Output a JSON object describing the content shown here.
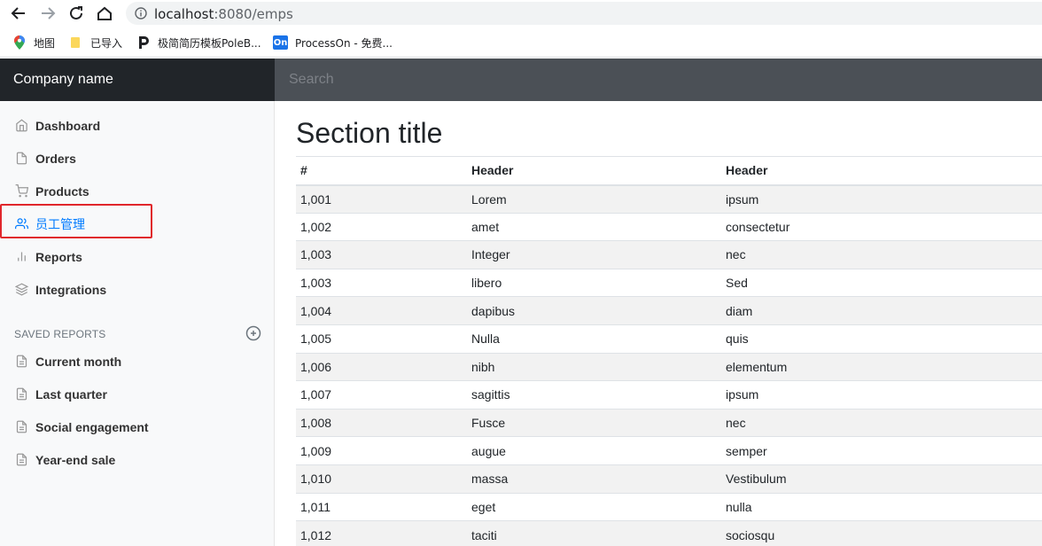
{
  "browser": {
    "url_host": "localhost",
    "url_path": ":8080/emps",
    "bookmarks": [
      "地图",
      "已导入",
      "极简简历模板PoleB...",
      "ProcessOn - 免费..."
    ],
    "processon_icon_text": "On"
  },
  "navbar": {
    "brand": "Company name",
    "search_placeholder": "Search"
  },
  "sidebar": {
    "items": [
      {
        "label": "Dashboard",
        "icon": "home-icon"
      },
      {
        "label": "Orders",
        "icon": "file-icon"
      },
      {
        "label": "Products",
        "icon": "shopping-cart-icon"
      },
      {
        "label": "员工管理",
        "icon": "users-icon",
        "active": true
      },
      {
        "label": "Reports",
        "icon": "bar-chart-icon"
      },
      {
        "label": "Integrations",
        "icon": "layers-icon"
      }
    ],
    "saved_heading": "SAVED REPORTS",
    "saved_items": [
      {
        "label": "Current month",
        "icon": "file-text-icon"
      },
      {
        "label": "Last quarter",
        "icon": "file-text-icon"
      },
      {
        "label": "Social engagement",
        "icon": "file-text-icon"
      },
      {
        "label": "Year-end sale",
        "icon": "file-text-icon"
      }
    ]
  },
  "main": {
    "title": "Section title",
    "columns": [
      "#",
      "Header",
      "Header"
    ],
    "rows": [
      [
        "1,001",
        "Lorem",
        "ipsum"
      ],
      [
        "1,002",
        "amet",
        "consectetur"
      ],
      [
        "1,003",
        "Integer",
        "nec"
      ],
      [
        "1,003",
        "libero",
        "Sed"
      ],
      [
        "1,004",
        "dapibus",
        "diam"
      ],
      [
        "1,005",
        "Nulla",
        "quis"
      ],
      [
        "1,006",
        "nibh",
        "elementum"
      ],
      [
        "1,007",
        "sagittis",
        "ipsum"
      ],
      [
        "1,008",
        "Fusce",
        "nec"
      ],
      [
        "1,009",
        "augue",
        "semper"
      ],
      [
        "1,010",
        "massa",
        "Vestibulum"
      ],
      [
        "1,011",
        "eget",
        "nulla"
      ],
      [
        "1,012",
        "taciti",
        "sociosqu"
      ]
    ]
  },
  "colors": {
    "active": "#007bff",
    "highlight": "#e0262b"
  }
}
